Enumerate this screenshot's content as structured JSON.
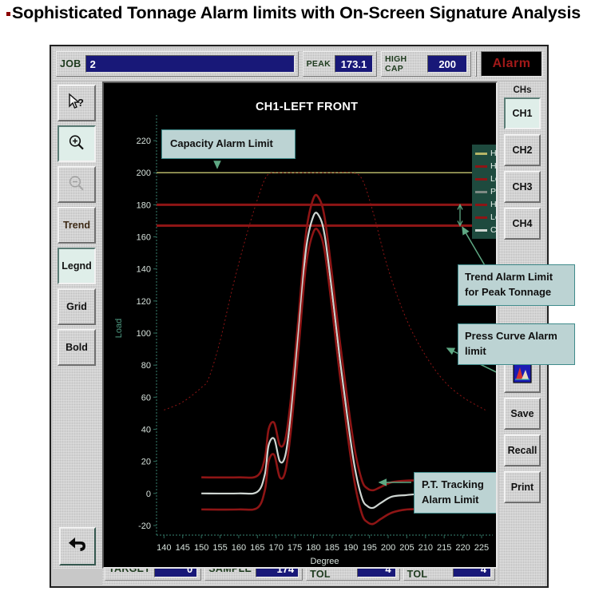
{
  "slide": {
    "heading": "Sophisticated Tonnage Alarm limits with On-Screen Signature Analysis"
  },
  "top_bar": {
    "job_label": "JOB",
    "job_value": "2",
    "peak_label": "PEAK",
    "peak_value": "173.1",
    "high_cap_label": "HIGH CAP",
    "high_cap_value": "200",
    "alarm_label": "Alarm",
    "alarm_color": "#a11919"
  },
  "left_toolbar": {
    "items": [
      {
        "name": "help-pointer",
        "label": "",
        "icon": "help-cursor-icon",
        "state": "normal"
      },
      {
        "name": "zoom-in",
        "label": "",
        "icon": "magnifier-plus-icon",
        "state": "pressed"
      },
      {
        "name": "zoom-out",
        "label": "",
        "icon": "magnifier-minus-icon",
        "state": "disabled"
      },
      {
        "name": "trend",
        "label": "Trend",
        "icon": "",
        "state": "normal"
      },
      {
        "name": "legend",
        "label": "Legnd",
        "icon": "",
        "state": "pressed"
      },
      {
        "name": "grid",
        "label": "Grid",
        "icon": "",
        "state": "normal"
      },
      {
        "name": "bold",
        "label": "Bold",
        "icon": "",
        "state": "normal"
      }
    ],
    "back_button": {
      "label": "",
      "icon": "back-arrow-icon"
    }
  },
  "right_toolbar": {
    "channels_label": "CHs",
    "channels": [
      {
        "label": "CH1",
        "state": "pressed"
      },
      {
        "label": "CH2",
        "state": "normal"
      },
      {
        "label": "CH3",
        "state": "normal"
      },
      {
        "label": "CH4",
        "state": "normal"
      }
    ],
    "buttons": [
      {
        "name": "signature-view",
        "label": "",
        "icon": "signature-chart-icon"
      },
      {
        "name": "save",
        "label": "Save",
        "icon": ""
      },
      {
        "name": "recall",
        "label": "Recall",
        "icon": ""
      },
      {
        "name": "print",
        "label": "Print",
        "icon": ""
      }
    ]
  },
  "bottom_bar": {
    "fields": [
      {
        "label": "TARGET",
        "value": "0"
      },
      {
        "label": "SAMPLE",
        "value": "174"
      },
      {
        "label": "HIGH TOL",
        "value": "4"
      },
      {
        "label": "LOW TOL",
        "value": "4"
      }
    ]
  },
  "callouts": {
    "capacity": "Capacity Alarm Limit",
    "pt_tracking_line1": "P.T. Tracking",
    "pt_tracking_line2": "Alarm Limit",
    "trend_line1": "Trend Alarm Limit",
    "trend_line2": "for Peak Tonnage",
    "press_line1": "Press Curve Alarm",
    "press_line2": "limit"
  },
  "chart_data": {
    "type": "line",
    "title": "CH1-LEFT FRONT",
    "xlabel": "Degree",
    "ylabel": "Load",
    "xlim": [
      138,
      228
    ],
    "ylim": [
      -26,
      232
    ],
    "xticks": [
      140,
      145,
      150,
      155,
      160,
      165,
      170,
      175,
      180,
      185,
      190,
      195,
      200,
      205,
      210,
      215,
      220,
      225
    ],
    "yticks": [
      -20,
      0,
      20,
      40,
      60,
      80,
      100,
      120,
      140,
      160,
      180,
      200,
      220
    ],
    "grid": false,
    "legend_position": "top-right",
    "legend": [
      {
        "label": "High Capacity",
        "color": "#b5b567"
      },
      {
        "label": "High Trend",
        "color": "#8e1515"
      },
      {
        "label": "Low Trend",
        "color": "#8e1515"
      },
      {
        "label": "Press Curve",
        "color": "#7e8a84"
      },
      {
        "label": "High Tracking",
        "color": "#8e1515"
      },
      {
        "label": "Low Tracking",
        "color": "#8e1515"
      },
      {
        "label": "Current",
        "color": "#cfd6d2"
      }
    ],
    "horizontal_limits": [
      {
        "name": "High Capacity",
        "value": 200,
        "color": "#b5b567"
      },
      {
        "name": "High Trend",
        "value": 180,
        "color": "#8e1515"
      },
      {
        "name": "Low Trend",
        "value": 167,
        "color": "#8e1515"
      }
    ],
    "series": [
      {
        "name": "Press Curve",
        "color": "#8e1515",
        "style": "dashed",
        "x": [
          140,
          145,
          150,
          152,
          155,
          158,
          161,
          164,
          167,
          169,
          171,
          175,
          180,
          185,
          190,
          193,
          196,
          200,
          205,
          210,
          215,
          220,
          226
        ],
        "y": [
          52,
          57,
          66,
          72,
          95,
          125,
          152,
          176,
          196,
          200,
          200,
          200,
          200,
          200,
          200,
          196,
          175,
          140,
          108,
          86,
          70,
          60,
          52
        ]
      },
      {
        "name": "High Tracking",
        "color": "#8e1515",
        "style": "solid",
        "x": [
          150,
          160,
          165,
          167,
          168,
          169.5,
          171,
          172.5,
          174,
          176,
          178,
          180,
          181.5,
          183,
          185,
          187,
          189,
          191,
          193,
          194.5,
          196,
          198,
          201,
          205,
          210,
          215,
          220,
          226
        ],
        "y": [
          10,
          10,
          11,
          22,
          40,
          44,
          30,
          34,
          60,
          110,
          162,
          184,
          184,
          172,
          136,
          96,
          60,
          28,
          8,
          3,
          2,
          4,
          7,
          8,
          8,
          8,
          8,
          8
        ]
      },
      {
        "name": "Current",
        "color": "#cfd6d2",
        "style": "solid",
        "x": [
          150,
          160,
          165,
          167,
          168,
          169.5,
          171,
          172.5,
          174,
          176,
          178,
          180,
          181.5,
          183,
          185,
          187,
          189,
          191,
          193,
          194.5,
          196,
          198,
          201,
          205,
          210,
          215,
          220,
          226
        ],
        "y": [
          0,
          0,
          1,
          12,
          30,
          34,
          20,
          24,
          50,
          100,
          152,
          173,
          173,
          161,
          125,
          85,
          49,
          17,
          -3,
          -8,
          -9,
          -6,
          -2,
          -1,
          0,
          0,
          0,
          0
        ]
      },
      {
        "name": "Low Tracking",
        "color": "#8e1515",
        "style": "solid",
        "x": [
          150,
          160,
          165,
          167,
          168,
          169.5,
          171,
          172.5,
          174,
          176,
          178,
          180,
          181.5,
          183,
          185,
          187,
          189,
          191,
          193,
          194.5,
          196,
          198,
          201,
          205,
          210,
          215,
          220,
          226
        ],
        "y": [
          -10,
          -10,
          -9,
          2,
          20,
          24,
          10,
          14,
          40,
          90,
          142,
          163,
          163,
          151,
          115,
          75,
          39,
          7,
          -13,
          -18,
          -19,
          -16,
          -12,
          -10,
          -10,
          -10,
          -10,
          -10
        ]
      }
    ],
    "annotations": [
      {
        "text": "Capacity Alarm Limit",
        "points_to": "High Capacity line at 200"
      },
      {
        "text": "Trend Alarm Limit for Peak Tonnage",
        "points_to": "band between 180 and 167"
      },
      {
        "text": "Press Curve Alarm limit",
        "points_to": "descending dashed press curve"
      },
      {
        "text": "P.T. Tracking Alarm Limit",
        "points_to": "high tracking envelope"
      }
    ]
  }
}
